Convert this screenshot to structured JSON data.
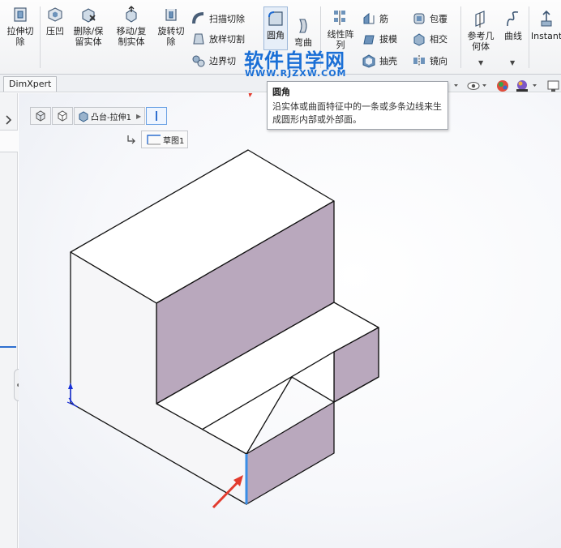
{
  "ribbon": {
    "extrude_cut": "拉伸切\n除",
    "indent": "压凹",
    "delete_keep_body": "删除/保\n留实体",
    "move_copy_body": "移动/复\n制实体",
    "revolved_cut": "旋转切\n除",
    "swept_cut": "扫描切除",
    "lofted_cut": "放样切割",
    "boundary_cut": "边界切",
    "fillet": "圆角",
    "flex": "弯曲",
    "linear_pattern": "线性阵\n列",
    "rib": "筋",
    "draft": "拔模",
    "shell": "抽壳",
    "wrap": "包覆",
    "intersect": "相交",
    "mirror": "镜向",
    "reference_geometry": "参考几\n何体",
    "curves": "曲线",
    "instant3d": "Instant"
  },
  "tabs": {
    "dimxpert": "DimXpert"
  },
  "breadcrumb": {
    "feature": "凸台-拉伸1",
    "sketch": "草图1"
  },
  "tooltip": {
    "title": "圆角",
    "body": "沿实体或曲面特征中的一条或多条边线来生成圆形内部或外部面。"
  },
  "watermark": {
    "main": "软件自学网",
    "url": "WWW.RJZXW.COM"
  },
  "colors": {
    "ribbon_bg": "#f1f2f4",
    "model_face_white": "#ffffff",
    "model_face_side": "#b9a8bd",
    "highlight_edge": "#3a8ee6",
    "arrow_red": "#e23b2e",
    "watermark_blue": "#1a6fd6"
  }
}
